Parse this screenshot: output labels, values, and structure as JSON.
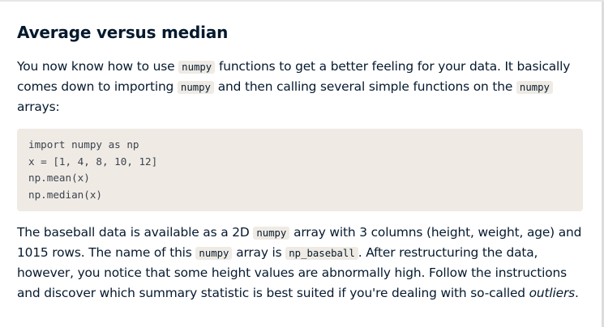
{
  "title": "Average versus median",
  "para1": {
    "line1": {
      "a": "You now know how to use ",
      "code": "numpy",
      "b": " functions to get a better feeling for your data. It basically"
    },
    "line2": {
      "a": "comes down to importing ",
      "code1": "numpy",
      "b": " and then calling several simple functions on the ",
      "code2": "numpy"
    },
    "line3": {
      "a": "arrays:"
    }
  },
  "code_block": {
    "lines": [
      "import numpy as np",
      "x = [1, 4, 8, 10, 12]",
      "np.mean(x)",
      "np.median(x)"
    ]
  },
  "para2": {
    "line1": {
      "a": "The baseball data is available as a 2D ",
      "code": "numpy",
      "b": " array with 3 columns (height, weight, age) and"
    },
    "line2": {
      "a": "1015 rows. The name of this ",
      "code1": "numpy",
      "b": " array is ",
      "code2": "np_baseball",
      "c": ". After restructuring the data,"
    },
    "line3": {
      "a": "however, you notice that some height values are abnormally high. Follow the instructions"
    },
    "line4": {
      "a": "and discover which summary statistic is best suited if you're dealing with so-called ",
      "em": "outliers",
      "b": "."
    }
  }
}
